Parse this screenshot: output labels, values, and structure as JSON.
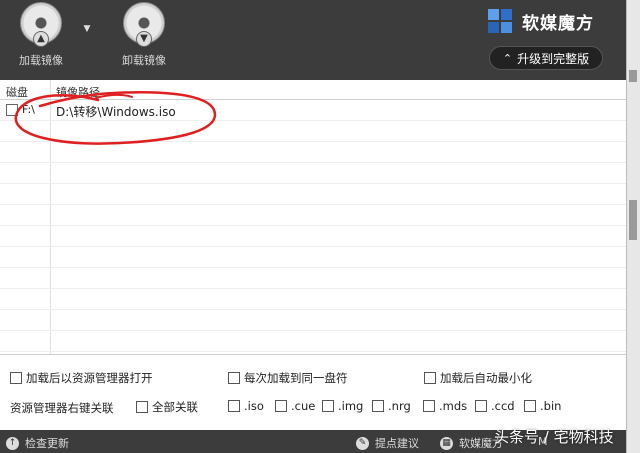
{
  "toolbar": {
    "mount_label": "加载镜像",
    "unmount_label": "卸载镜像",
    "mount_icon": "disc-mount-icon",
    "unmount_icon": "disc-unmount-icon",
    "dropdown_icon": "chevron-down-icon"
  },
  "brand": {
    "name": "软媒魔方",
    "upgrade_label": "升级到完整版",
    "upgrade_icon": "double-chevron-up-icon"
  },
  "table": {
    "columns": [
      "磁盘",
      "镜像路径"
    ],
    "rows": [
      {
        "checked": false,
        "drive": "F:\\",
        "path": "D:\\转移\\Windows.iso"
      }
    ]
  },
  "options": {
    "open_explorer_after_mount": {
      "label": "加载后以资源管理器打开",
      "checked": false
    },
    "mount_to_same_letter": {
      "label": "每次加载到同一盘符",
      "checked": false
    },
    "minimize_after_mount": {
      "label": "加载后自动最小化",
      "checked": false
    },
    "context_menu_label": "资源管理器右键关联",
    "all_assoc": {
      "label": "全部关联",
      "checked": false
    },
    "extensions": [
      {
        "label": ".iso",
        "checked": false
      },
      {
        "label": ".cue",
        "checked": false
      },
      {
        "label": ".img",
        "checked": false
      },
      {
        "label": ".nrg",
        "checked": false
      },
      {
        "label": ".mds",
        "checked": false
      },
      {
        "label": ".ccd",
        "checked": false
      },
      {
        "label": ".bin",
        "checked": false
      }
    ]
  },
  "statusbar": {
    "check_update": "检查更新",
    "feedback": "提点建议",
    "mofang": "软媒魔方",
    "extra": "M"
  },
  "watermark": "头条号 / 宅物科技",
  "colors": {
    "toolbar_bg": "#3c3c3c",
    "annotation": "#e02020",
    "brand_blue": "#3a7fd5"
  }
}
